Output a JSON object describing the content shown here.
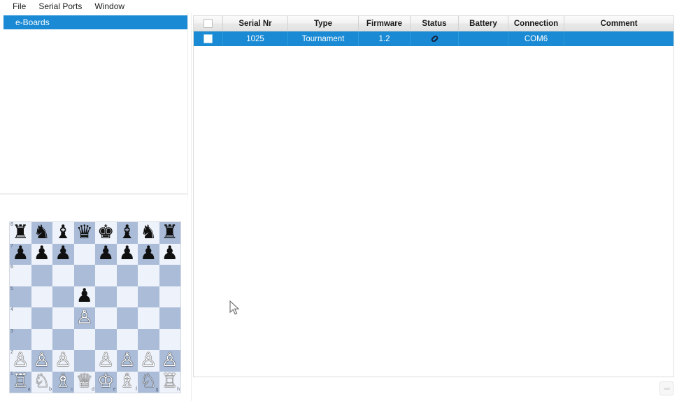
{
  "app": {
    "menu": [
      {
        "label": "File"
      },
      {
        "label": "Serial Ports"
      },
      {
        "label": "Window"
      }
    ]
  },
  "sidebar": {
    "tree": [
      {
        "label": "e-Boards",
        "selected": true
      }
    ]
  },
  "table": {
    "columns": [
      {
        "key": "check",
        "label": "",
        "width": 42
      },
      {
        "key": "serial_nr",
        "label": "Serial Nr",
        "width": 93
      },
      {
        "key": "type",
        "label": "Type",
        "width": 101
      },
      {
        "key": "firmware",
        "label": "Firmware",
        "width": 74
      },
      {
        "key": "status",
        "label": "Status",
        "width": 69
      },
      {
        "key": "battery",
        "label": "Battery",
        "width": 71
      },
      {
        "key": "connection",
        "label": "Connection",
        "width": 80
      },
      {
        "key": "comment",
        "label": "Comment",
        "width": 156
      }
    ],
    "rows": [
      {
        "selected": true,
        "checked": false,
        "serial_nr": "1025",
        "type": "Tournament",
        "firmware": "1.2",
        "status_icon": "link-icon",
        "battery": "",
        "connection": "COM6",
        "comment": ""
      }
    ]
  },
  "board": {
    "orientation": "white-bottom",
    "rank_labels": [
      "8",
      "7",
      "6",
      "5",
      "4",
      "3",
      "2",
      "1"
    ],
    "file_labels": [
      "a",
      "b",
      "c",
      "d",
      "e",
      "f",
      "g",
      "h"
    ],
    "position_fen": "rnbqkbnr/ppp1pppp/8/3p4/3P4/8/PPP1PPPP/RNBQKBNR",
    "ranks": [
      [
        "r",
        "n",
        "b",
        "q",
        "k",
        "b",
        "n",
        "r"
      ],
      [
        "p",
        "p",
        "p",
        "",
        "p",
        "p",
        "p",
        "p"
      ],
      [
        "",
        "",
        "",
        "",
        "",
        "",
        "",
        ""
      ],
      [
        "",
        "",
        "",
        "p",
        "",
        "",
        "",
        ""
      ],
      [
        "",
        "",
        "",
        "P",
        "",
        "",
        "",
        ""
      ],
      [
        "",
        "",
        "",
        "",
        "",
        "",
        "",
        ""
      ],
      [
        "P",
        "P",
        "P",
        "",
        "P",
        "P",
        "P",
        "P"
      ],
      [
        "R",
        "N",
        "B",
        "Q",
        "K",
        "B",
        "N",
        "R"
      ]
    ]
  },
  "footer": {
    "grip_label": ""
  },
  "colors": {
    "selection_blue": "#1a8ad4",
    "board_light": "#eef2fa",
    "board_dark": "#aabcd8",
    "header_text": "#1b1b1b"
  }
}
